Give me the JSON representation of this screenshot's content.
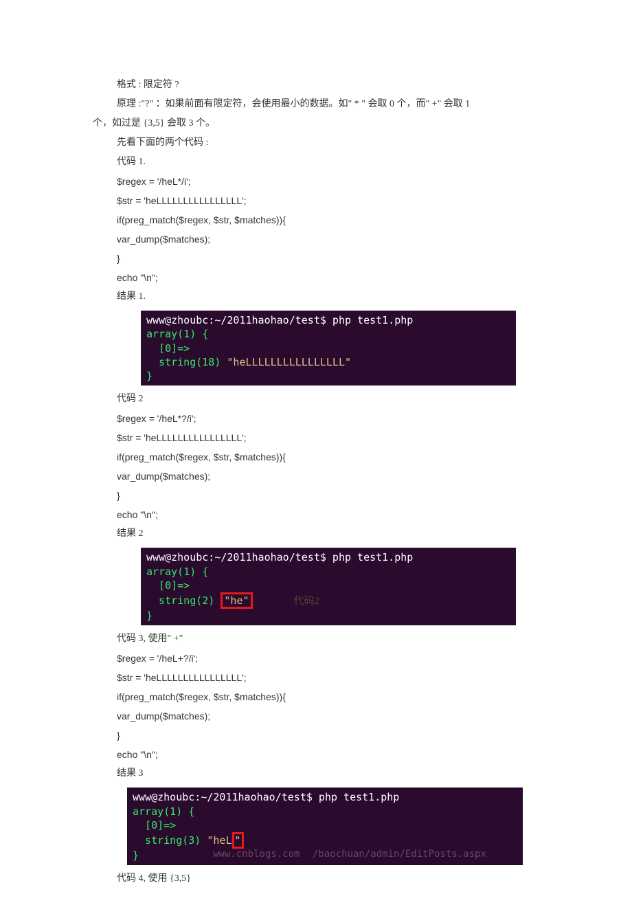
{
  "intro": {
    "p1": "格式 : 限定符 ?",
    "p2": "原理 :\"?\"  ：如果前面有限定符，会使用最小的数据。如\"    * \" 会取 0 个，而\" +\" 会取 1",
    "p2b": "个，如过是 {3,5}  会取 3 个。",
    "p3": "先看下面的两个代码  :",
    "p4": "代码 1."
  },
  "code1": {
    "l1": "$regex = '/heL*/i';",
    "l2": "$str = 'heLLLLLLLLLLLLLLLL';",
    "l3": "if(preg_match($regex, $str, $matches)){",
    "l4": "var_dump($matches);",
    "l5": "}",
    "l6": "echo \"\\n\";"
  },
  "res1label": "结果 1.",
  "term1": {
    "l1a": "www@zhoubc:~/2011haohao/test$",
    "l1b": " php test1.php",
    "l2": "array(1) {",
    "l3": "  [0]=>",
    "l4a": "  string(18) ",
    "l4b": "\"heLLLLLLLLLLLLLLLL\"",
    "l5": "}"
  },
  "code2label": "代码 2",
  "code2": {
    "l1": "$regex = '/heL*?/i';",
    "l2": "$str = 'heLLLLLLLLLLLLLLLL';",
    "l3": "if(preg_match($regex, $str, $matches)){",
    "l4": "var_dump($matches);",
    "l5": "}",
    "l6": "echo \"\\n\";"
  },
  "res2label": "结果 2",
  "term2": {
    "l1a": "www@zhoubc:~/2011haohao/test$",
    "l1b": " php test1.php",
    "l2": "array(1) {",
    "l3": "  [0]=>",
    "l4a": "  string(2) ",
    "l4b": "\"he\"",
    "l5": "}",
    "code2text": "代码2"
  },
  "code3label": "代码 3, 使用\" +\"",
  "code3": {
    "l1": "$regex = '/heL+?/i';",
    "l2": "$str = 'heLLLLLLLLLLLLLLLL';",
    "l3": "if(preg_match($regex, $str, $matches)){",
    "l4": "var_dump($matches);",
    "l5": "}",
    "l6": "echo \"\\n\";"
  },
  "res3label": "结果 3",
  "term3": {
    "l1a": "www@zhoubc:~/2011haohao/test$",
    "l1b": " php test1.php",
    "l2": "array(1) {",
    "l3": "  [0]=>",
    "l4a": "  string(3) ",
    "l4b": "\"heL",
    "l4c": "\"",
    "l5": "}",
    "faint_cnblogs": "www.cnblogs.com",
    "faint_path": "/baochuan/admin/EditPosts.aspx"
  },
  "code4label": "代码 4, 使用 {3,5}"
}
